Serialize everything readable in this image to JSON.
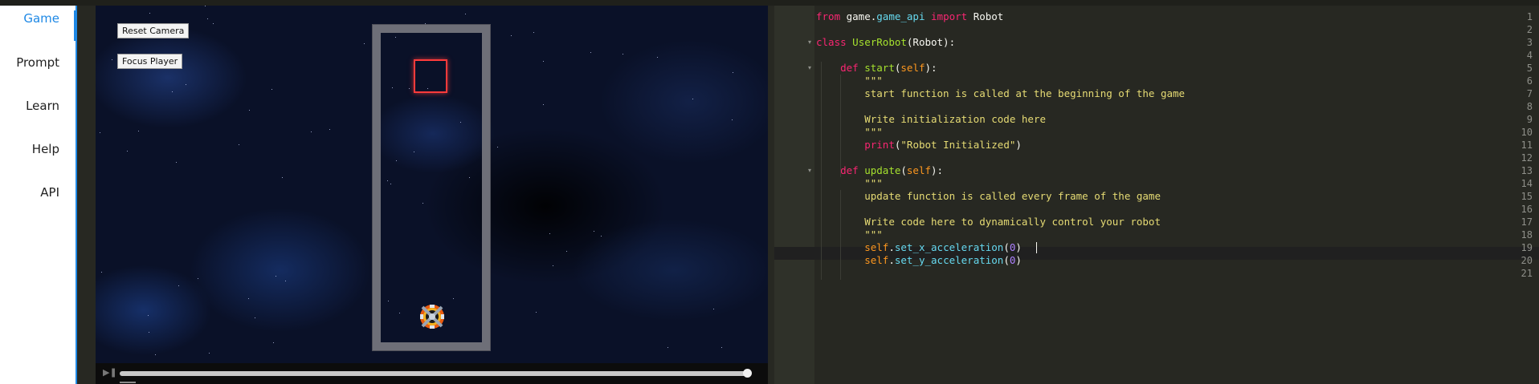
{
  "sidebar": {
    "items": [
      {
        "label": "Game",
        "active": true
      },
      {
        "label": "Prompt"
      },
      {
        "label": "Learn"
      },
      {
        "label": "Help"
      },
      {
        "label": "API"
      }
    ]
  },
  "game": {
    "reset_camera_label": "Reset Camera",
    "focus_player_label": "Focus Player",
    "playback_progress": 1.0
  },
  "editor": {
    "lines": [
      {
        "n": "1",
        "parts": [
          [
            "kw",
            "from"
          ],
          [
            "plain",
            " game."
          ],
          [
            "call",
            "game_api"
          ],
          [
            "plain",
            " "
          ],
          [
            "kw",
            "import"
          ],
          [
            "plain",
            " Robot"
          ]
        ]
      },
      {
        "n": "2",
        "parts": []
      },
      {
        "n": "3",
        "fold": true,
        "parts": [
          [
            "kw",
            "class"
          ],
          [
            "plain",
            " "
          ],
          [
            "cls",
            "UserRobot"
          ],
          [
            "plain",
            "(Robot):"
          ]
        ]
      },
      {
        "n": "4",
        "parts": []
      },
      {
        "n": "5",
        "fold": true,
        "parts": [
          [
            "plain",
            "    "
          ],
          [
            "kw",
            "def"
          ],
          [
            "plain",
            " "
          ],
          [
            "fn",
            "start"
          ],
          [
            "plain",
            "("
          ],
          [
            "self",
            "self"
          ],
          [
            "plain",
            "):"
          ]
        ]
      },
      {
        "n": "6",
        "parts": [
          [
            "plain",
            "        "
          ],
          [
            "str",
            "\"\"\""
          ]
        ]
      },
      {
        "n": "7",
        "parts": [
          [
            "plain",
            "        "
          ],
          [
            "str",
            "start function is called at the beginning of the game"
          ]
        ]
      },
      {
        "n": "8",
        "parts": []
      },
      {
        "n": "9",
        "parts": [
          [
            "plain",
            "        "
          ],
          [
            "str",
            "Write initialization code here"
          ]
        ]
      },
      {
        "n": "10",
        "parts": [
          [
            "plain",
            "        "
          ],
          [
            "str",
            "\"\"\""
          ]
        ]
      },
      {
        "n": "11",
        "parts": [
          [
            "plain",
            "        "
          ],
          [
            "kw",
            "print"
          ],
          [
            "plain",
            "("
          ],
          [
            "str",
            "\"Robot Initialized\""
          ],
          [
            "plain",
            ")"
          ]
        ]
      },
      {
        "n": "12",
        "parts": []
      },
      {
        "n": "13",
        "fold": true,
        "parts": [
          [
            "plain",
            "    "
          ],
          [
            "kw",
            "def"
          ],
          [
            "plain",
            " "
          ],
          [
            "fn",
            "update"
          ],
          [
            "plain",
            "("
          ],
          [
            "self",
            "self"
          ],
          [
            "plain",
            "):"
          ]
        ]
      },
      {
        "n": "14",
        "parts": [
          [
            "plain",
            "        "
          ],
          [
            "str",
            "\"\"\""
          ]
        ]
      },
      {
        "n": "15",
        "parts": [
          [
            "plain",
            "        "
          ],
          [
            "str",
            "update function is called every frame of the game"
          ]
        ]
      },
      {
        "n": "16",
        "parts": []
      },
      {
        "n": "17",
        "parts": [
          [
            "plain",
            "        "
          ],
          [
            "str",
            "Write code here to dynamically control your robot"
          ]
        ]
      },
      {
        "n": "18",
        "parts": [
          [
            "plain",
            "        "
          ],
          [
            "str",
            "\"\"\""
          ]
        ]
      },
      {
        "n": "19",
        "parts": [
          [
            "plain",
            "        "
          ],
          [
            "self",
            "self"
          ],
          [
            "plain",
            "."
          ],
          [
            "call",
            "set_x_acceleration"
          ],
          [
            "plain",
            "("
          ],
          [
            "num",
            "0"
          ],
          [
            "plain",
            ")"
          ]
        ]
      },
      {
        "n": "20",
        "parts": [
          [
            "plain",
            "        "
          ],
          [
            "self",
            "self"
          ],
          [
            "plain",
            "."
          ],
          [
            "call",
            "set_y_acceleration"
          ],
          [
            "plain",
            "("
          ],
          [
            "num",
            "0"
          ],
          [
            "plain",
            ")"
          ]
        ]
      },
      {
        "n": "21",
        "parts": []
      }
    ],
    "active_line": 20
  },
  "colors": {
    "accent": "#1e88e5",
    "editor_bg": "#272822",
    "target_border": "#ff3b3b",
    "arena_wall": "#6e6f78"
  }
}
